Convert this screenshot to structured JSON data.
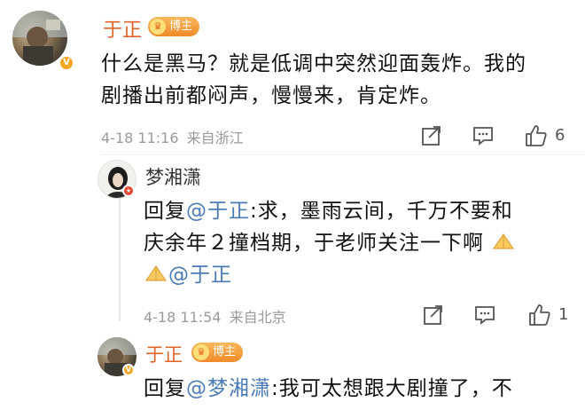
{
  "comments": [
    {
      "username": "于正",
      "tag": "博主",
      "verified": "V",
      "text": "什么是黑马？就是低调中突然迎面轰炸。我的剧播出前都闷声，慢慢来，肯定炸。",
      "line1": "什么是黑马？就是低调中突然迎面轰炸。我的",
      "line2": "剧播出前都闷声，慢慢来，肯定炸。",
      "time": "4-18 11:16",
      "location": "来自浙江",
      "likes": "6"
    },
    {
      "username": "梦湘潇",
      "reply_prefix": "回复",
      "mention": "@于正",
      "line1_rest": ":求，墨雨云间，千万不要和",
      "line2": "庆余年２撞档期，于老师关注一下啊",
      "line3_mention": "@于正",
      "time": "4-18 11:54",
      "location": "来自北京",
      "likes": "1"
    },
    {
      "username": "于正",
      "tag": "博主",
      "reply_prefix": "回复",
      "mention": "@梦湘潇",
      "line1_rest": ":我可太想跟大剧撞了，不"
    }
  ],
  "colors": {
    "accent_orange": "#e0632a",
    "mention_blue": "#4a7bb5",
    "meta_gray": "#9a9a9a"
  },
  "icons": {
    "share": "share-icon",
    "comment": "comment-icon",
    "like": "thumbs-up-icon",
    "emoji": "praying-hands-emoji-icon"
  }
}
